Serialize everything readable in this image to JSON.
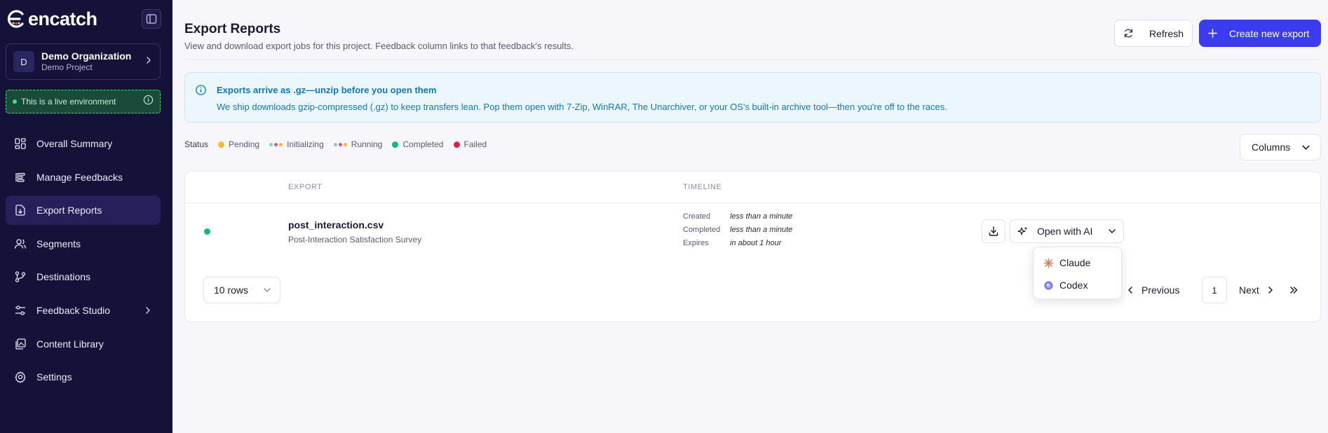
{
  "app": {
    "brand": "encatch"
  },
  "org": {
    "avatar_letter": "D",
    "name": "Demo Organization",
    "project": "Demo Project"
  },
  "environment": {
    "label": "This is a live environment"
  },
  "nav": [
    {
      "label": "Overall Summary",
      "icon": "dashboard-icon"
    },
    {
      "label": "Manage Feedbacks",
      "icon": "list-icon"
    },
    {
      "label": "Export Reports",
      "icon": "export-icon",
      "active": true
    },
    {
      "label": "Segments",
      "icon": "users-icon"
    },
    {
      "label": "Destinations",
      "icon": "branch-icon"
    },
    {
      "label": "Feedback Studio",
      "icon": "sliders-icon",
      "has_children": true
    },
    {
      "label": "Content Library",
      "icon": "library-icon"
    },
    {
      "label": "Settings",
      "icon": "gear-icon"
    }
  ],
  "header": {
    "title": "Export Reports",
    "subtitle": "View and download export jobs for this project. Feedback column links to that feedback's results.",
    "refresh_label": "Refresh",
    "create_label": "Create new export"
  },
  "banner": {
    "title": "Exports arrive as .gz—unzip before you open them",
    "text": "We ship downloads gzip-compressed (.gz) to keep transfers lean. Pop them open with 7-Zip, WinRAR, The Unarchiver, or your OS's built-in archive tool—then you're off to the races."
  },
  "status_legend": {
    "label": "Status",
    "items": [
      {
        "label": "Pending",
        "color": "#f5b82e"
      },
      {
        "label": "Initializing",
        "colors": [
          "#7dd3c8",
          "#e84a8a",
          "#f5b82e"
        ]
      },
      {
        "label": "Running",
        "colors": [
          "#7dd3c8",
          "#e84a8a",
          "#f5b82e"
        ]
      },
      {
        "label": "Completed",
        "color": "#10b981"
      },
      {
        "label": "Failed",
        "color": "#e11d48"
      }
    ]
  },
  "columns_button": {
    "label": "Columns"
  },
  "table": {
    "headers": {
      "export": "EXPORT",
      "timeline": "TIMELINE"
    },
    "rows": [
      {
        "status": "Completed",
        "status_color": "#10b981",
        "file": "post_interaction.csv",
        "survey": "Post-Interaction Satisfaction Survey",
        "timeline": [
          {
            "label": "Created",
            "value": "less than a minute"
          },
          {
            "label": "Completed",
            "value": "less than a minute"
          },
          {
            "label": "Expires",
            "value": "in about 1 hour"
          }
        ],
        "ai_label": "Open with AI"
      }
    ]
  },
  "pagination": {
    "rows_label": "10 rows",
    "prev_label": "Previous",
    "page": "1",
    "next_label": "Next"
  },
  "ai_menu": {
    "options": [
      {
        "label": "Claude",
        "color": "#d97757"
      },
      {
        "label": "Codex",
        "color": "#6b6bf5"
      }
    ]
  }
}
